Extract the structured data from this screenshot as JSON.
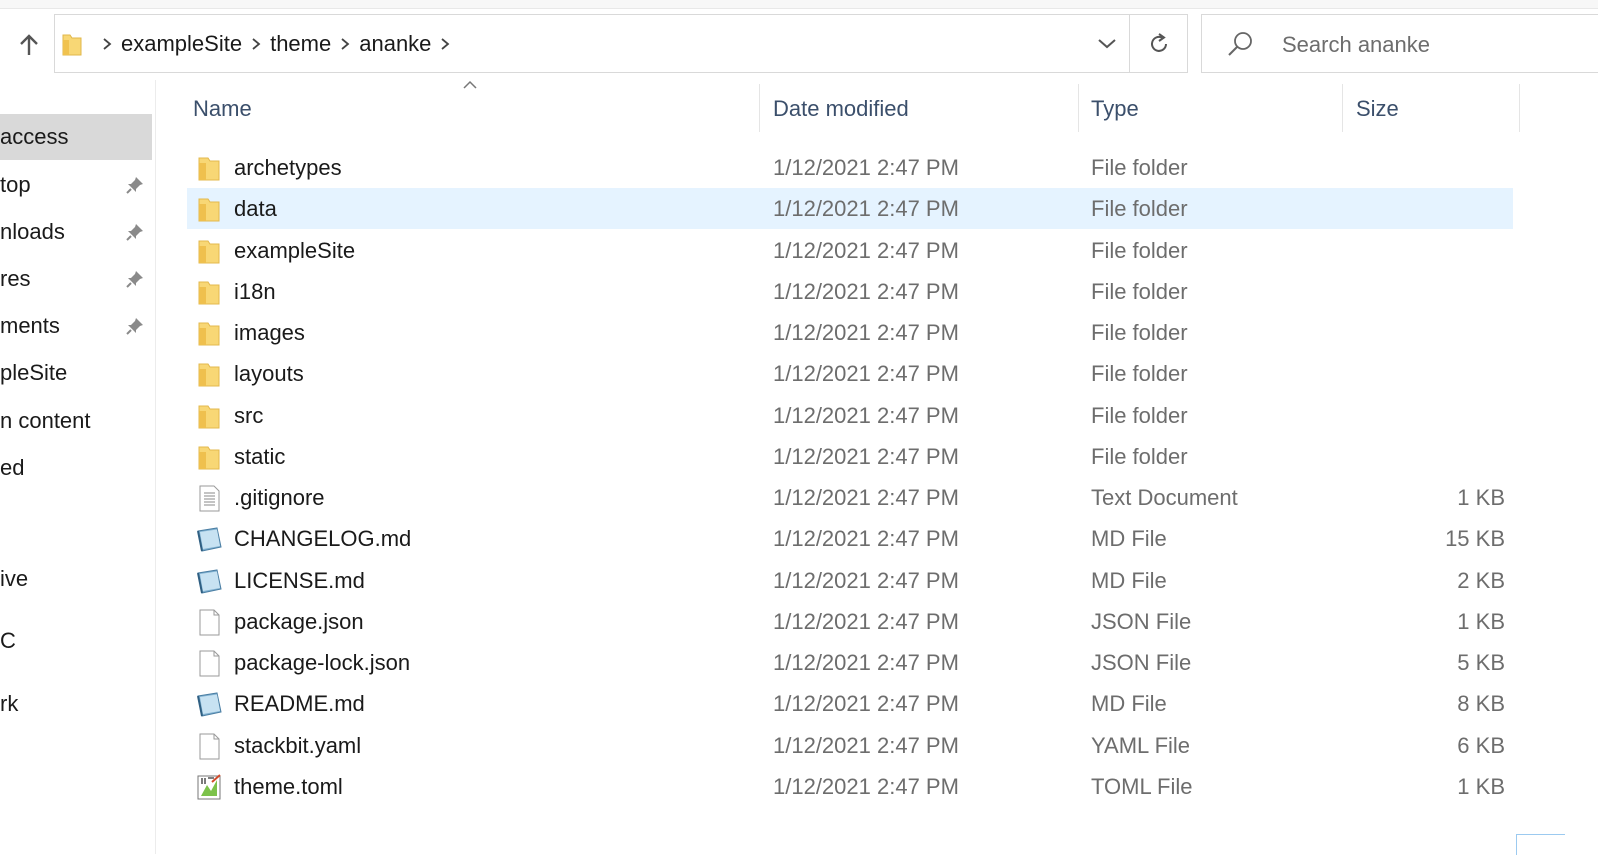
{
  "address_bar": {
    "crumbs": [
      "exampleSite",
      "theme",
      "ananke"
    ]
  },
  "search": {
    "placeholder": "Search ananke"
  },
  "nav_pane": {
    "items": [
      {
        "label": "access",
        "pinned": false,
        "selected": true
      },
      {
        "label": "top",
        "pinned": true,
        "selected": false
      },
      {
        "label": "nloads",
        "pinned": true,
        "selected": false
      },
      {
        "label": "res",
        "pinned": true,
        "selected": false
      },
      {
        "label": "ments",
        "pinned": true,
        "selected": false
      },
      {
        "label": "pleSite",
        "pinned": false,
        "selected": false
      },
      {
        "label": "n content",
        "pinned": false,
        "selected": false
      },
      {
        "label": "ed",
        "pinned": false,
        "selected": false
      },
      {
        "label": "ive",
        "pinned": false,
        "selected": false
      },
      {
        "label": "C",
        "pinned": false,
        "selected": false
      },
      {
        "label": "rk",
        "pinned": false,
        "selected": false
      }
    ]
  },
  "columns": {
    "name": "Name",
    "date": "Date modified",
    "type": "Type",
    "size": "Size"
  },
  "files": [
    {
      "name": "archetypes",
      "date": "1/12/2021 2:47 PM",
      "type": "File folder",
      "size": "",
      "icon": "folder-icon"
    },
    {
      "name": "data",
      "date": "1/12/2021 2:47 PM",
      "type": "File folder",
      "size": "",
      "icon": "folder-icon",
      "selected": true
    },
    {
      "name": "exampleSite",
      "date": "1/12/2021 2:47 PM",
      "type": "File folder",
      "size": "",
      "icon": "folder-icon"
    },
    {
      "name": "i18n",
      "date": "1/12/2021 2:47 PM",
      "type": "File folder",
      "size": "",
      "icon": "folder-icon"
    },
    {
      "name": "images",
      "date": "1/12/2021 2:47 PM",
      "type": "File folder",
      "size": "",
      "icon": "folder-icon"
    },
    {
      "name": "layouts",
      "date": "1/12/2021 2:47 PM",
      "type": "File folder",
      "size": "",
      "icon": "folder-icon"
    },
    {
      "name": "src",
      "date": "1/12/2021 2:47 PM",
      "type": "File folder",
      "size": "",
      "icon": "folder-icon"
    },
    {
      "name": "static",
      "date": "1/12/2021 2:47 PM",
      "type": "File folder",
      "size": "",
      "icon": "folder-icon"
    },
    {
      "name": ".gitignore",
      "date": "1/12/2021 2:47 PM",
      "type": "Text Document",
      "size": "1 KB",
      "icon": "text-file-icon"
    },
    {
      "name": "CHANGELOG.md",
      "date": "1/12/2021 2:47 PM",
      "type": "MD File",
      "size": "15 KB",
      "icon": "md-file-icon"
    },
    {
      "name": "LICENSE.md",
      "date": "1/12/2021 2:47 PM",
      "type": "MD File",
      "size": "2 KB",
      "icon": "md-file-icon"
    },
    {
      "name": "package.json",
      "date": "1/12/2021 2:47 PM",
      "type": "JSON File",
      "size": "1 KB",
      "icon": "blank-file-icon"
    },
    {
      "name": "package-lock.json",
      "date": "1/12/2021 2:47 PM",
      "type": "JSON File",
      "size": "5 KB",
      "icon": "blank-file-icon"
    },
    {
      "name": "README.md",
      "date": "1/12/2021 2:47 PM",
      "type": "MD File",
      "size": "8 KB",
      "icon": "md-file-icon"
    },
    {
      "name": "stackbit.yaml",
      "date": "1/12/2021 2:47 PM",
      "type": "YAML File",
      "size": "6 KB",
      "icon": "blank-file-icon"
    },
    {
      "name": "theme.toml",
      "date": "1/12/2021 2:47 PM",
      "type": "TOML File",
      "size": "1 KB",
      "icon": "toml-file-icon"
    }
  ],
  "colors": {
    "header_text": "#3b4f6b",
    "selected_row": "#e5f3ff",
    "nav_selected": "#d9d9d9",
    "folder_yellow": "#f8d775"
  }
}
